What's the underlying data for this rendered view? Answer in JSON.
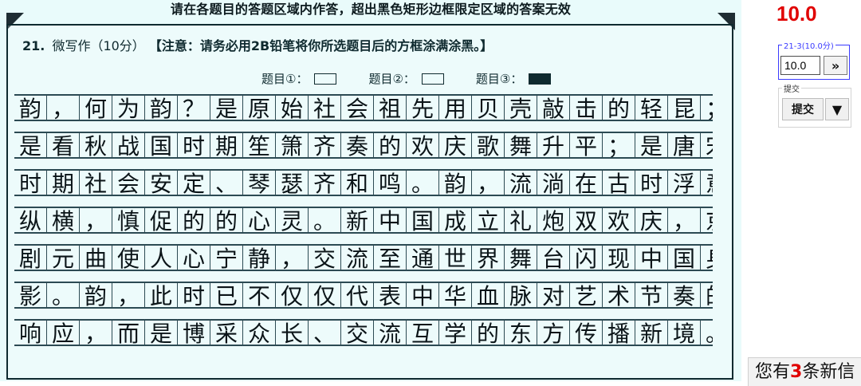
{
  "sheet": {
    "top_banner": "请在各题目的答题区域内作答，超出黑色矩形边框限定区域的答案无效",
    "question": {
      "number": "21.",
      "title": "微写作（10分）",
      "note": "【注意：请务必用2B铅笔将你所选题目后的方框涂满涂黑。】"
    },
    "topics": [
      {
        "label": "题目①：",
        "selected": false
      },
      {
        "label": "题目②：",
        "selected": false
      },
      {
        "label": "题目③：",
        "selected": true
      }
    ],
    "handwriting_lines": [
      "韵，何为韵？是原始社会祖先用贝壳敲击的轻昆；",
      "是看秋战国时期笙箫齐奏的欢庆歌舞升平；是唐宋",
      "时期社会安定、琴瑟齐和鸣。韵，流淌在古时浮意",
      "纵横，慎促的的心灵。新中国成立礼炮双欢庆，京",
      "剧元曲使人心宁静，交流至通世界舞台闪现中国身",
      "影。韵，此时已不仅仅代表中华血脉对艺术节奏的",
      "响应，而是博采众长、交流互学的东方传播新境。"
    ]
  },
  "right_panel": {
    "score_display": "10.0",
    "score_box_legend": "21-3(10.0分)",
    "score_input_value": "10.0",
    "next_button_label": "»",
    "submit_legend": "提交",
    "submit_button_label": "提交",
    "submit_dropdown_label": "▼",
    "notification": {
      "prefix": "您有",
      "count": "3",
      "suffix": "条新信"
    }
  }
}
